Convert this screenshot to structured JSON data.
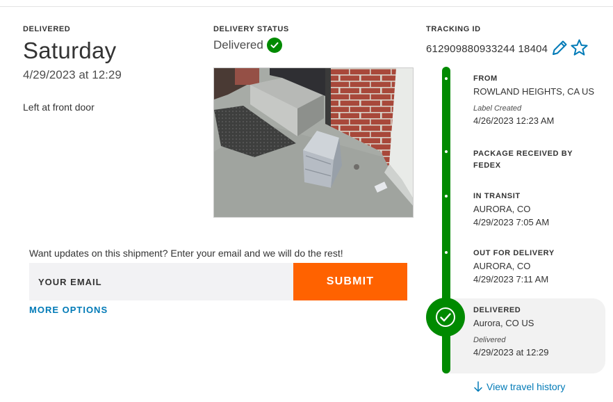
{
  "delivered_section": {
    "eyebrow": "DELIVERED",
    "day": "Saturday",
    "datetime": "4/29/2023 at 12:29",
    "note": "Left at front door"
  },
  "status_section": {
    "eyebrow": "DELIVERY STATUS",
    "status": "Delivered",
    "status_icon": "check-circle-icon",
    "status_color": "#008a00"
  },
  "tracking": {
    "eyebrow": "TRACKING ID",
    "id": "612909880933244 18404",
    "icons": [
      "pencil-icon",
      "star-icon"
    ]
  },
  "email_form": {
    "prompt": "Want updates on this shipment? Enter your email and we will do the rest!",
    "placeholder": "YOUR EMAIL",
    "submit_label": "SUBMIT",
    "submit_color": "#ff6200",
    "more_options": "MORE OPTIONS"
  },
  "timeline": {
    "accent_color": "#008a00",
    "steps": [
      {
        "title": "FROM",
        "location": "ROWLAND HEIGHTS, CA US",
        "note": "Label Created",
        "time": "4/26/2023 12:23 AM"
      },
      {
        "title": "PACKAGE RECEIVED BY FEDEX"
      },
      {
        "title": "IN TRANSIT",
        "location": "AURORA, CO",
        "time": "4/29/2023 7:05 AM"
      },
      {
        "title": "OUT FOR DELIVERY",
        "location": "AURORA, CO",
        "time": "4/29/2023 7:11 AM"
      },
      {
        "title": "DELIVERED",
        "location": "Aurora, CO US",
        "note": "Delivered",
        "time": "4/29/2023 at 12:29"
      }
    ],
    "view_history": "View travel history"
  }
}
